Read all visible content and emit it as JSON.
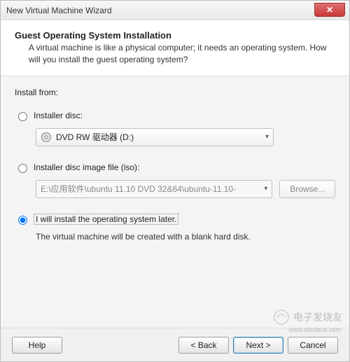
{
  "window": {
    "title": "New Virtual Machine Wizard",
    "close_glyph": "✕"
  },
  "header": {
    "title": "Guest Operating System Installation",
    "description": "A virtual machine is like a physical computer; it needs an operating system. How will you install the guest operating system?"
  },
  "body": {
    "install_from_label": "Install from:",
    "option_disc": {
      "label": "Installer disc:",
      "selected_value": "DVD RW 驱动器 (D:)",
      "checked": false
    },
    "option_iso": {
      "label": "Installer disc image file (iso):",
      "path_value": "E:\\应用软件\\ubuntu 11.10 DVD 32&64\\ubuntu-11.10-",
      "browse_label": "Browse...",
      "checked": false,
      "enabled": false
    },
    "option_later": {
      "label": "I will install the operating system later.",
      "description": "The virtual machine will be created with a blank hard disk.",
      "checked": true
    }
  },
  "footer": {
    "help_label": "Help",
    "back_label": "< Back",
    "next_label": "Next >",
    "cancel_label": "Cancel"
  },
  "watermark": {
    "brand": "电子发烧友",
    "url": "www.elecfans.com"
  }
}
